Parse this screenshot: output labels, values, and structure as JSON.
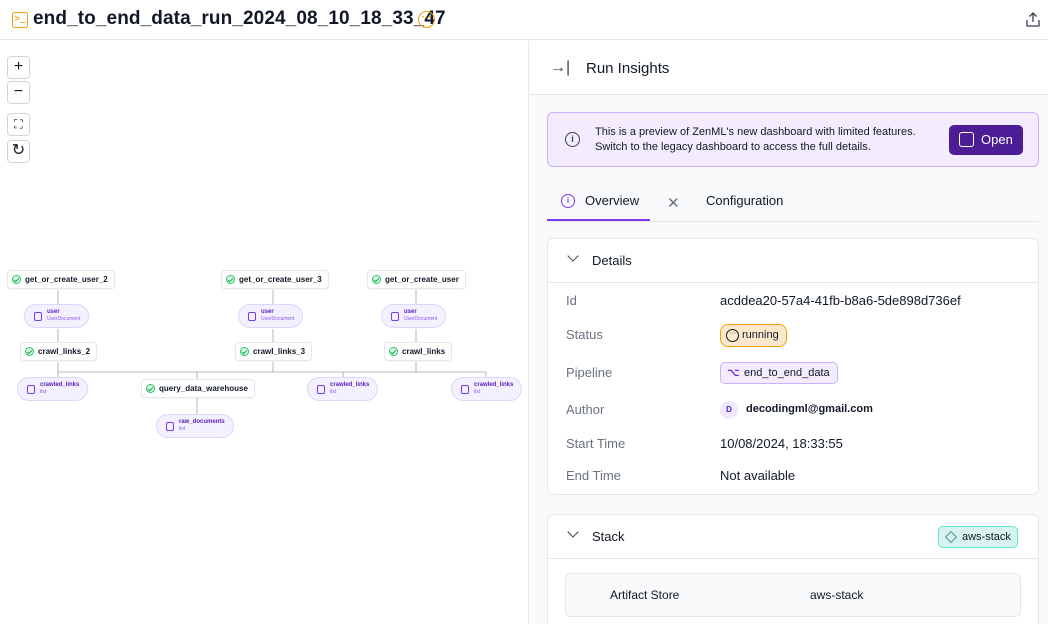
{
  "header": {
    "run_name": "end_to_end_data_run_2024_08_10_18_33_47"
  },
  "dag": {
    "zoom_controls": [
      "+",
      "−",
      "⛶",
      "↻"
    ],
    "steps": {
      "get_user_2": "get_or_create_user_2",
      "get_user_3": "get_or_create_user_3",
      "get_user": "get_or_create_user",
      "crawl_2": "crawl_links_2",
      "crawl_3": "crawl_links_3",
      "crawl": "crawl_links",
      "query": "query_data_warehouse"
    },
    "artifacts": {
      "user_a": {
        "name": "user",
        "type": "UserDocument"
      },
      "user_b": {
        "name": "user",
        "type": "UserDocument"
      },
      "user_c": {
        "name": "user",
        "type": "UserDocument"
      },
      "crawled_a": {
        "name": "crawled_links",
        "type": "list"
      },
      "crawled_b": {
        "name": "crawled_links",
        "type": "list"
      },
      "crawled_c": {
        "name": "crawled_links",
        "type": "list"
      },
      "raw": {
        "name": "raw_documents",
        "type": "list"
      }
    }
  },
  "panel": {
    "title": "Run Insights",
    "banner": {
      "line1": "This is a preview of ZenML's new dashboard with limited features.",
      "line2": "Switch to the legacy dashboard to access the full details.",
      "open_label": "Open"
    },
    "tabs": {
      "overview": "Overview",
      "configuration": "Configuration"
    },
    "details": {
      "title": "Details",
      "id_label": "Id",
      "id_value": "acddea20-57a4-41fb-b8a6-5de898d736ef",
      "status_label": "Status",
      "status_value": "running",
      "pipeline_label": "Pipeline",
      "pipeline_value": "end_to_end_data",
      "author_label": "Author",
      "author_initial": "D",
      "author_value": "decodingml@gmail.com",
      "start_label": "Start Time",
      "start_value": "10/08/2024, 18:33:55",
      "end_label": "End Time",
      "end_value": "Not available"
    },
    "stack": {
      "title": "Stack",
      "badge": "aws-stack",
      "artifact_store_label": "Artifact Store",
      "artifact_store_value": "aws-stack"
    }
  },
  "colors": {
    "accent": "#7c3aed",
    "running": "#f59e0b",
    "success": "#22c55e",
    "open_button": "#4c1d95"
  }
}
